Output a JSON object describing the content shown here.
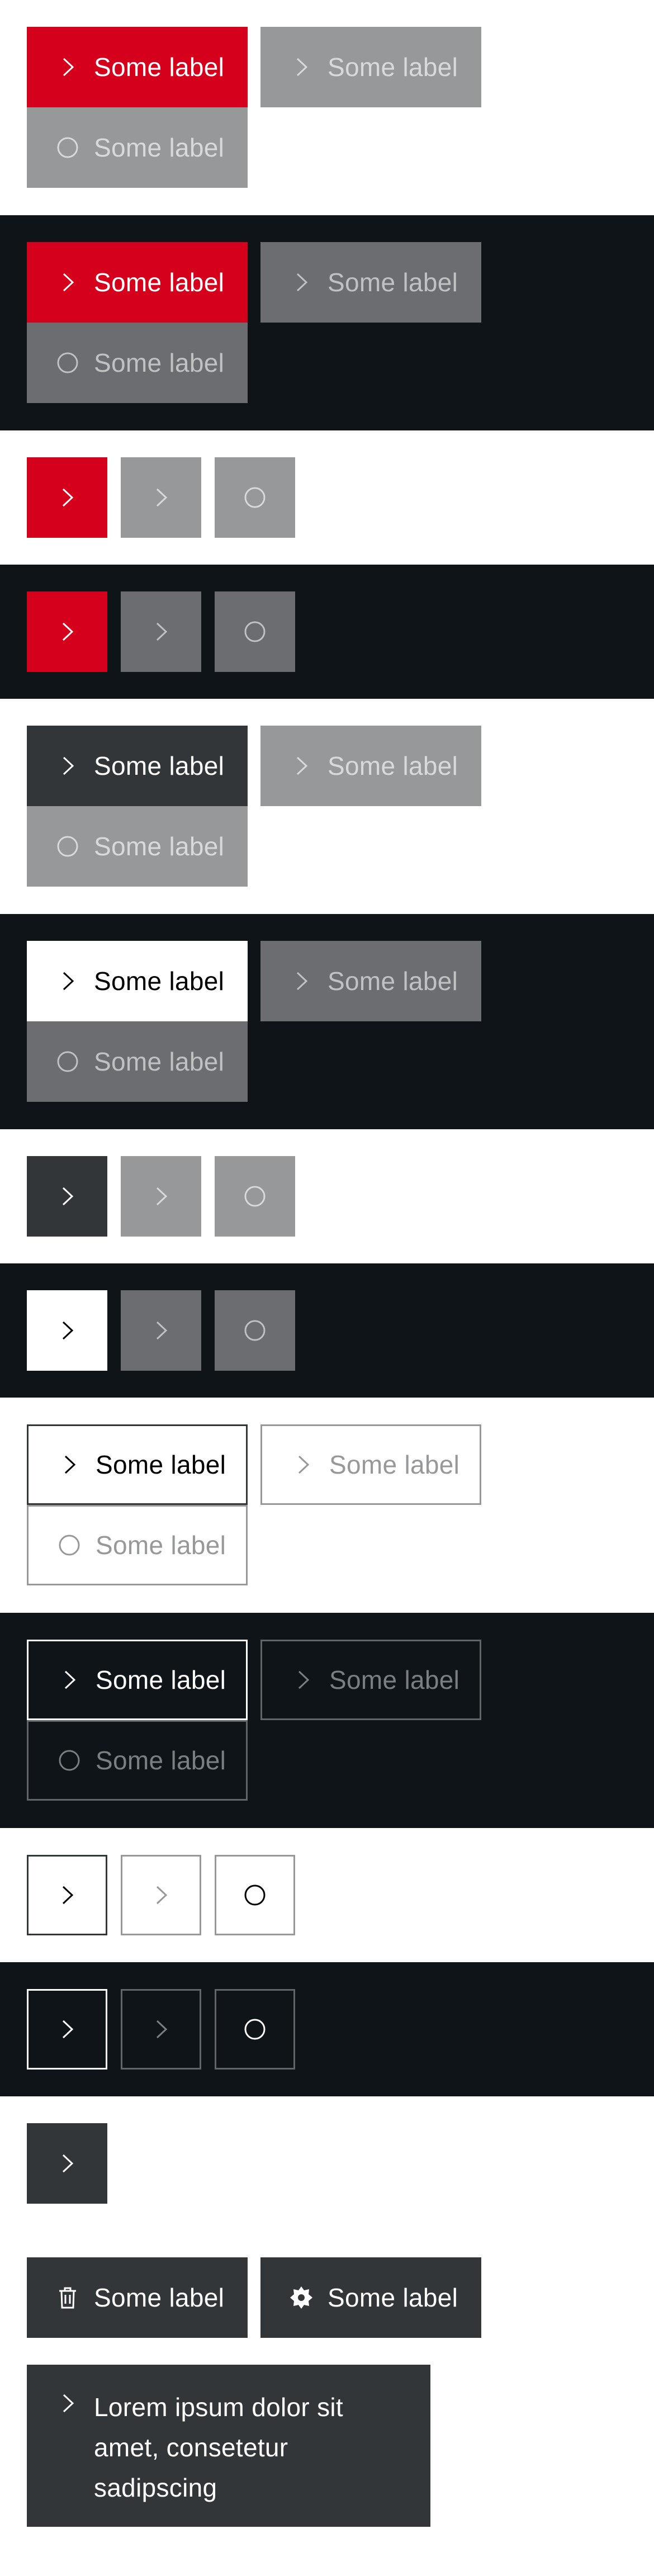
{
  "label": "Some label",
  "long_text": "Lorem ipsum dolor sit amet, consetetur sadipscing",
  "icons": {
    "arrow": "arrow-right-icon",
    "spinner": "spinner-icon",
    "delete": "delete-icon",
    "configure": "configure-icon"
  },
  "colors": {
    "primary_red": "#d5001c",
    "dark_background": "#0e1418",
    "secondary_dark": "#323639",
    "disabled_light": "#96989a",
    "disabled_dark": "#6b6d70"
  }
}
